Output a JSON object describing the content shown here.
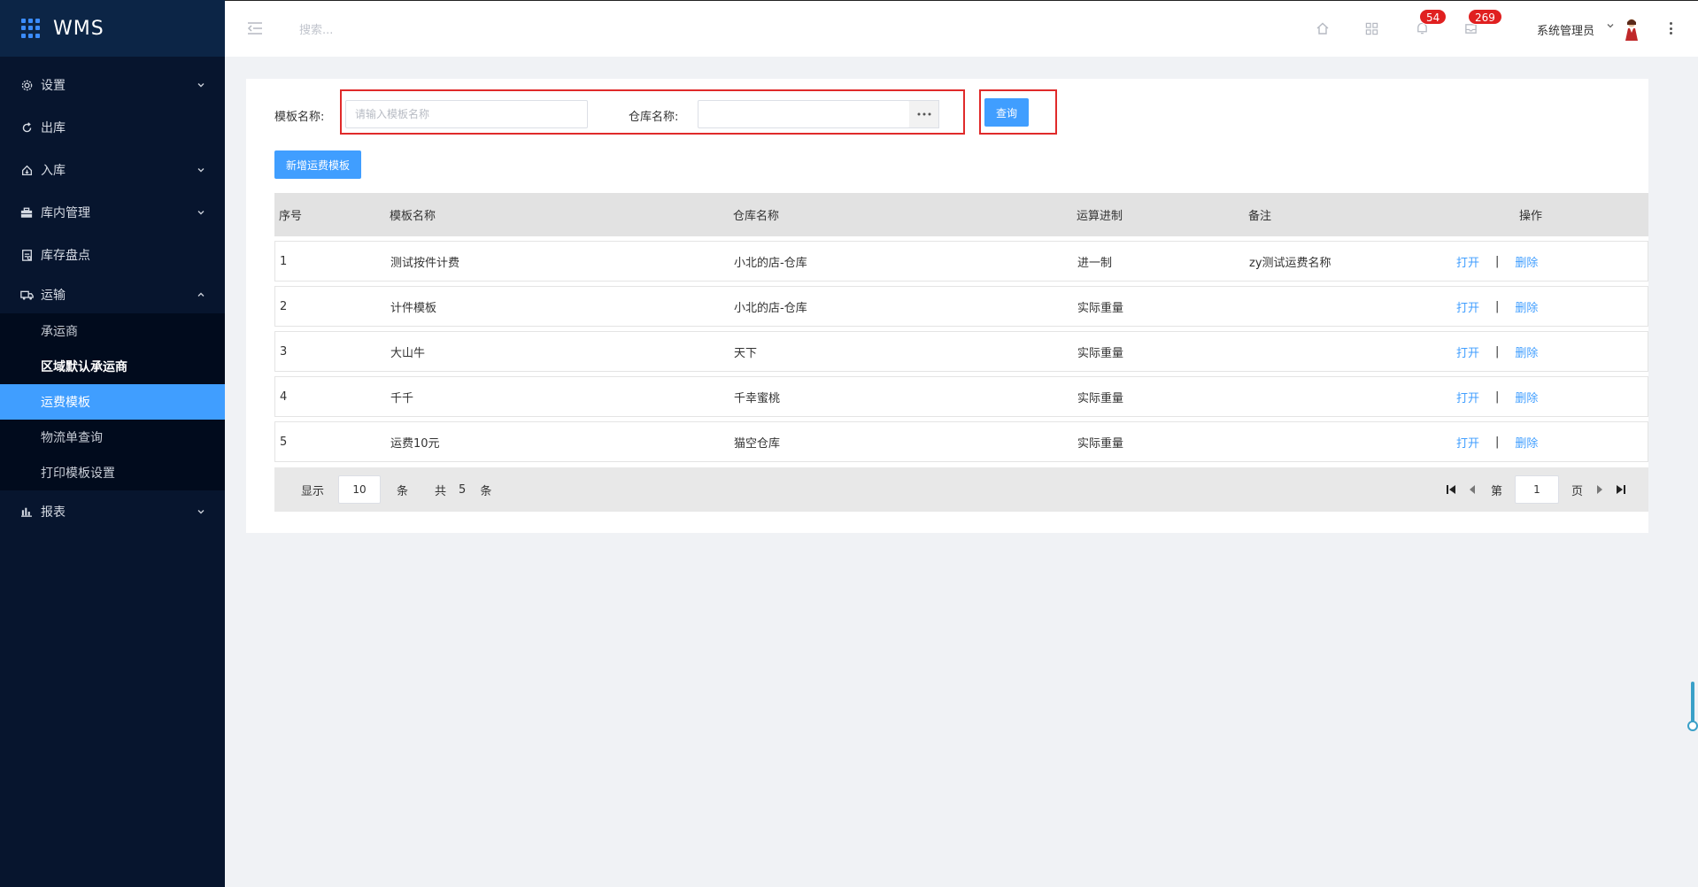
{
  "app": {
    "title": "WMS"
  },
  "sidebar": {
    "items": [
      {
        "label": "设置",
        "icon": "gear-icon",
        "expandable": true
      },
      {
        "label": "出库",
        "icon": "outbound-icon",
        "expandable": false
      },
      {
        "label": "入库",
        "icon": "inbound-icon",
        "expandable": true
      },
      {
        "label": "库内管理",
        "icon": "briefcase-icon",
        "expandable": true
      },
      {
        "label": "库存盘点",
        "icon": "clipboard-icon",
        "expandable": false
      },
      {
        "label": "运输",
        "icon": "truck-icon",
        "expandable": true,
        "expanded": true
      },
      {
        "label": "报表",
        "icon": "bar-chart-icon",
        "expandable": true
      }
    ],
    "transport_sub": [
      {
        "label": "承运商"
      },
      {
        "label": "区域默认承运商"
      },
      {
        "label": "运费模板",
        "active": true
      },
      {
        "label": "物流单查询"
      },
      {
        "label": "打印模板设置"
      }
    ]
  },
  "header": {
    "search_placeholder": "搜索...",
    "notifications_count": "54",
    "messages_count": "269",
    "user_name": "系统管理员"
  },
  "filters": {
    "template_label": "模板名称:",
    "template_placeholder": "请输入模板名称",
    "template_value": "",
    "warehouse_label": "仓库名称:",
    "warehouse_value": "",
    "query_button": "查询",
    "add_button": "新增运费模板"
  },
  "table": {
    "headers": [
      "序号",
      "模板名称",
      "仓库名称",
      "运算进制",
      "备注",
      "操作"
    ],
    "rows": [
      [
        "1",
        "测试按件计费",
        "小北的店-仓库",
        "进一制",
        "zy测试运费名称"
      ],
      [
        "2",
        "计件模板",
        "小北的店-仓库",
        "实际重量",
        ""
      ],
      [
        "3",
        "大山牛",
        "天下",
        "实际重量",
        ""
      ],
      [
        "4",
        "千千",
        "千幸蜜桃",
        "实际重量",
        ""
      ],
      [
        "5",
        "运费10元",
        "猫空仓库",
        "实际重量",
        ""
      ]
    ],
    "open_label": "打开",
    "separator": "|",
    "delete_label": "删除"
  },
  "pagination": {
    "show_label": "显示",
    "page_size": "10",
    "unit_label": "条",
    "total_prefix": "共",
    "total": "5",
    "total_unit": "条",
    "page_prefix": "第",
    "current_page": "1",
    "page_suffix": "页"
  },
  "colors": {
    "sidebar_bg": "#07152e",
    "accent": "#409eff",
    "badge": "#e02020",
    "highlight_box": "#e02a2a"
  }
}
